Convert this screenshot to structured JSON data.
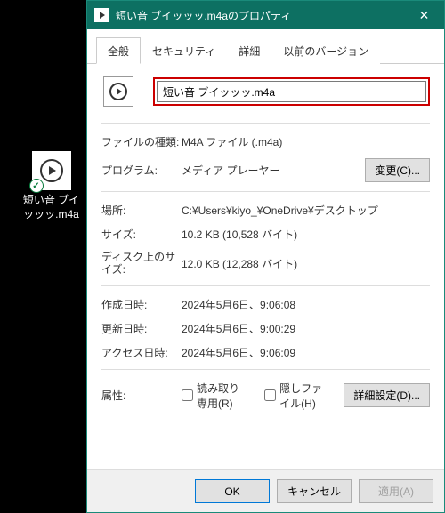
{
  "desktop": {
    "icon_label": "短い音 ブイッッッ.m4a"
  },
  "dialog": {
    "title": "短い音 ブイッッッ.m4aのプロパティ",
    "tabs": {
      "general": "全般",
      "security": "セキュリティ",
      "details": "詳細",
      "previous": "以前のバージョン"
    },
    "filename": "短い音 ブイッッッ.m4a",
    "rows": {
      "filetype_label": "ファイルの種類:",
      "filetype_value": "M4A ファイル (.m4a)",
      "program_label": "プログラム:",
      "program_value": "メディア プレーヤー",
      "change_btn": "変更(C)...",
      "location_label": "場所:",
      "location_value": "C:¥Users¥kiyo_¥OneDrive¥デスクトップ",
      "size_label": "サイズ:",
      "size_value": "10.2 KB (10,528 バイト)",
      "disksize_label": "ディスク上のサイズ:",
      "disksize_value": "12.0 KB (12,288 バイト)",
      "created_label": "作成日時:",
      "created_value": "2024年5月6日、9:06:08",
      "modified_label": "更新日時:",
      "modified_value": "2024年5月6日、9:00:29",
      "accessed_label": "アクセス日時:",
      "accessed_value": "2024年5月6日、9:06:09",
      "attrs_label": "属性:",
      "readonly_label": "読み取り専用(R)",
      "hidden_label": "隠しファイル(H)",
      "advanced_btn": "詳細設定(D)..."
    },
    "footer": {
      "ok": "OK",
      "cancel": "キャンセル",
      "apply": "適用(A)"
    }
  }
}
